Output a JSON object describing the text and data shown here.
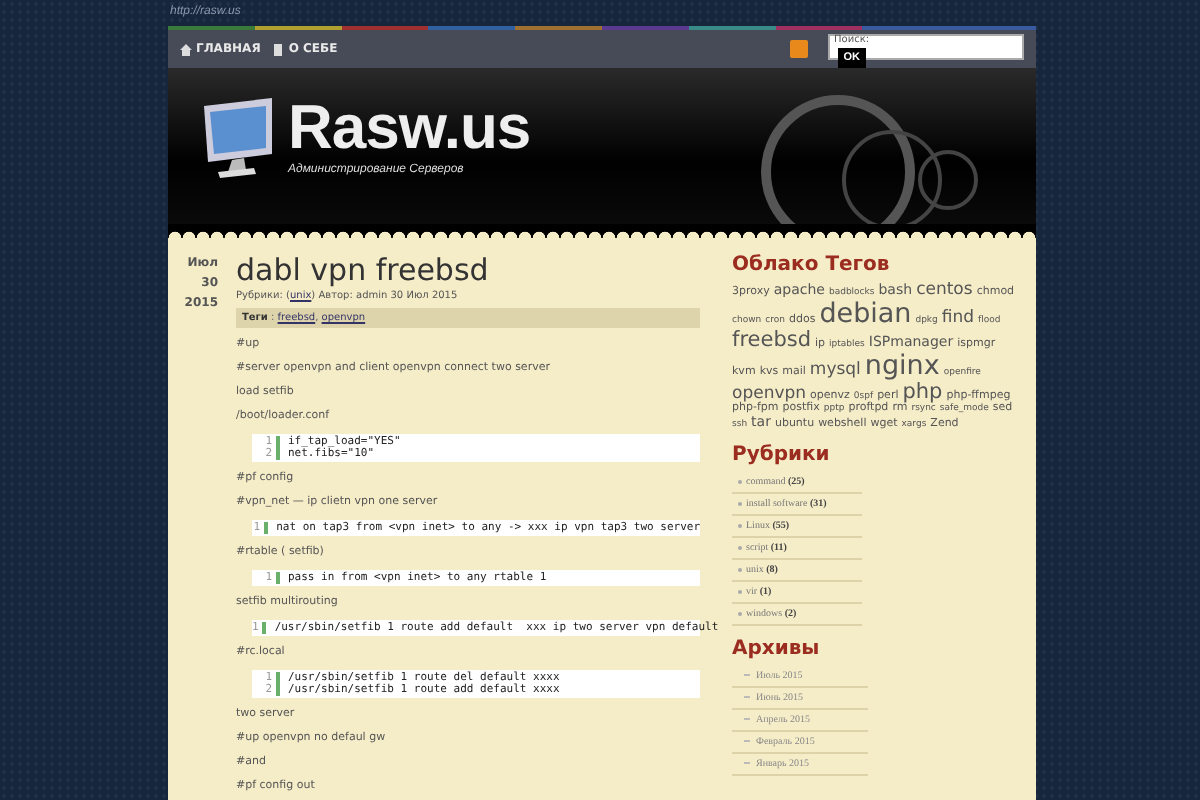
{
  "url": "http://rasw.us",
  "nav": [
    {
      "label": "ГЛАВНАЯ",
      "kind": "home"
    },
    {
      "label": "О СЕБЕ",
      "kind": "page"
    }
  ],
  "search": {
    "placeholder": "Поиск:",
    "button": "OK"
  },
  "header": {
    "title": "Rasw.us",
    "tagline": "Администрирование Серверов"
  },
  "post": {
    "date": "Июл 30",
    "year": "2015",
    "title": "dabl vpn freebsd",
    "meta_prefix": "Рубрики: (",
    "category": "unix",
    "meta_suffix": ") Автор: admin 30 Июл 2015",
    "tags_label": "Теги",
    "tags_colon": " : ",
    "tag_separator": ", ",
    "tags": [
      "freebsd",
      "openvpn"
    ],
    "body": [
      {
        "kind": "p",
        "text": "#up"
      },
      {
        "kind": "p",
        "text": "#server openvpn and client openvpn connect two server"
      },
      {
        "kind": "p",
        "text": "load setfib"
      },
      {
        "kind": "p",
        "text": "/boot/loader.conf"
      },
      {
        "kind": "code",
        "lines": [
          {
            "n": "1",
            "code": "if_tap_load=\"YES\""
          },
          {
            "n": "2",
            "code": "net.fibs=\"10\""
          }
        ]
      },
      {
        "kind": "p",
        "text": "#pf config"
      },
      {
        "kind": "p",
        "text": "#vpn_net — ip clietn vpn one server"
      },
      {
        "kind": "code",
        "lines": [
          {
            "n": "1",
            "code": "nat on tap3 from <vpn inet> to any -> xxx ip vpn tap3 two server"
          }
        ]
      },
      {
        "kind": "p",
        "text": "#rtable ( setfib)"
      },
      {
        "kind": "code",
        "lines": [
          {
            "n": "1",
            "code": "pass in from <vpn inet> to any rtable 1"
          }
        ]
      },
      {
        "kind": "p",
        "text": "setfib multirouting"
      },
      {
        "kind": "code",
        "lines": [
          {
            "n": "1",
            "code": "/usr/sbin/setfib 1 route add default  xxx ip two server vpn default"
          }
        ]
      },
      {
        "kind": "p",
        "text": "#rc.local"
      },
      {
        "kind": "code",
        "lines": [
          {
            "n": "1",
            "code": "/usr/sbin/setfib 1 route del default xxxx"
          },
          {
            "n": "2",
            "code": "/usr/sbin/setfib 1 route add default xxxx"
          }
        ]
      },
      {
        "kind": "p",
        "text": "two server"
      },
      {
        "kind": "p",
        "text": "#up openvpn no defaul gw"
      },
      {
        "kind": "p",
        "text": "#and"
      },
      {
        "kind": "p",
        "text": "#pf config out"
      }
    ]
  },
  "sidebar": [
    {
      "kind": "cloud",
      "title": "Облако Тегов",
      "tags": [
        {
          "label": "3proxy",
          "kind": "small"
        },
        {
          "label": "apache",
          "kind": "medium"
        },
        {
          "label": "badblocks",
          "kind": "tiny"
        },
        {
          "label": "bash",
          "kind": "medium"
        },
        {
          "label": "centos",
          "kind": "large"
        },
        {
          "label": "chmod",
          "kind": "small"
        },
        {
          "label": "chown",
          "kind": "tiny"
        },
        {
          "label": "cron",
          "kind": "tiny"
        },
        {
          "label": "ddos",
          "kind": "small"
        },
        {
          "label": "debian",
          "kind": "giant"
        },
        {
          "label": "dpkg",
          "kind": "tiny"
        },
        {
          "label": "find",
          "kind": "large"
        },
        {
          "label": "flood",
          "kind": "tiny"
        },
        {
          "label": "freebsd",
          "kind": "huge"
        },
        {
          "label": "ip",
          "kind": "small"
        },
        {
          "label": "iptables",
          "kind": "tiny"
        },
        {
          "label": "ISPmanager",
          "kind": "medium"
        },
        {
          "label": "ispmgr",
          "kind": "small"
        },
        {
          "label": "kvm",
          "kind": "small"
        },
        {
          "label": "kvs",
          "kind": "small"
        },
        {
          "label": "mail",
          "kind": "small"
        },
        {
          "label": "mysql",
          "kind": "large"
        },
        {
          "label": "nginx",
          "kind": "giant"
        },
        {
          "label": "openfire",
          "kind": "tiny"
        },
        {
          "label": "openvpn",
          "kind": "large"
        },
        {
          "label": "openvz",
          "kind": "small"
        },
        {
          "label": "0spf",
          "kind": "tiny"
        },
        {
          "label": "perl",
          "kind": "small"
        },
        {
          "label": "php",
          "kind": "huge"
        },
        {
          "label": "php-ffmpeg",
          "kind": "small"
        },
        {
          "label": "php-fpm",
          "kind": "small"
        },
        {
          "label": "postfix",
          "kind": "small"
        },
        {
          "label": "pptp",
          "kind": "tiny"
        },
        {
          "label": "proftpd",
          "kind": "small"
        },
        {
          "label": "rm",
          "kind": "small"
        },
        {
          "label": "rsync",
          "kind": "tiny"
        },
        {
          "label": "safe_mode",
          "kind": "tiny"
        },
        {
          "label": "sed",
          "kind": "small"
        },
        {
          "label": "ssh",
          "kind": "tiny"
        },
        {
          "label": "tar",
          "kind": "medium"
        },
        {
          "label": "ubuntu",
          "kind": "small"
        },
        {
          "label": "webshell",
          "kind": "small"
        },
        {
          "label": "wget",
          "kind": "small"
        },
        {
          "label": "xargs",
          "kind": "tiny"
        },
        {
          "label": "Zend",
          "kind": "small"
        }
      ]
    },
    {
      "kind": "list",
      "title": "Рубрики",
      "items": [
        {
          "label": "command",
          "count": "(25)"
        },
        {
          "label": "install software",
          "count": "(31)"
        },
        {
          "label": "Linux",
          "count": "(55)"
        },
        {
          "label": "script",
          "count": "(11)"
        },
        {
          "label": "unix",
          "count": "(8)"
        },
        {
          "label": "vir",
          "count": "(1)"
        },
        {
          "label": "windows",
          "count": "(2)"
        }
      ]
    },
    {
      "kind": "list",
      "title": "Архивы",
      "items": [
        {
          "label": "Июль 2015"
        },
        {
          "label": "Июнь 2015"
        },
        {
          "label": "Апрель 2015"
        },
        {
          "label": "Февраль 2015"
        },
        {
          "label": "Январь 2015"
        }
      ]
    }
  ]
}
